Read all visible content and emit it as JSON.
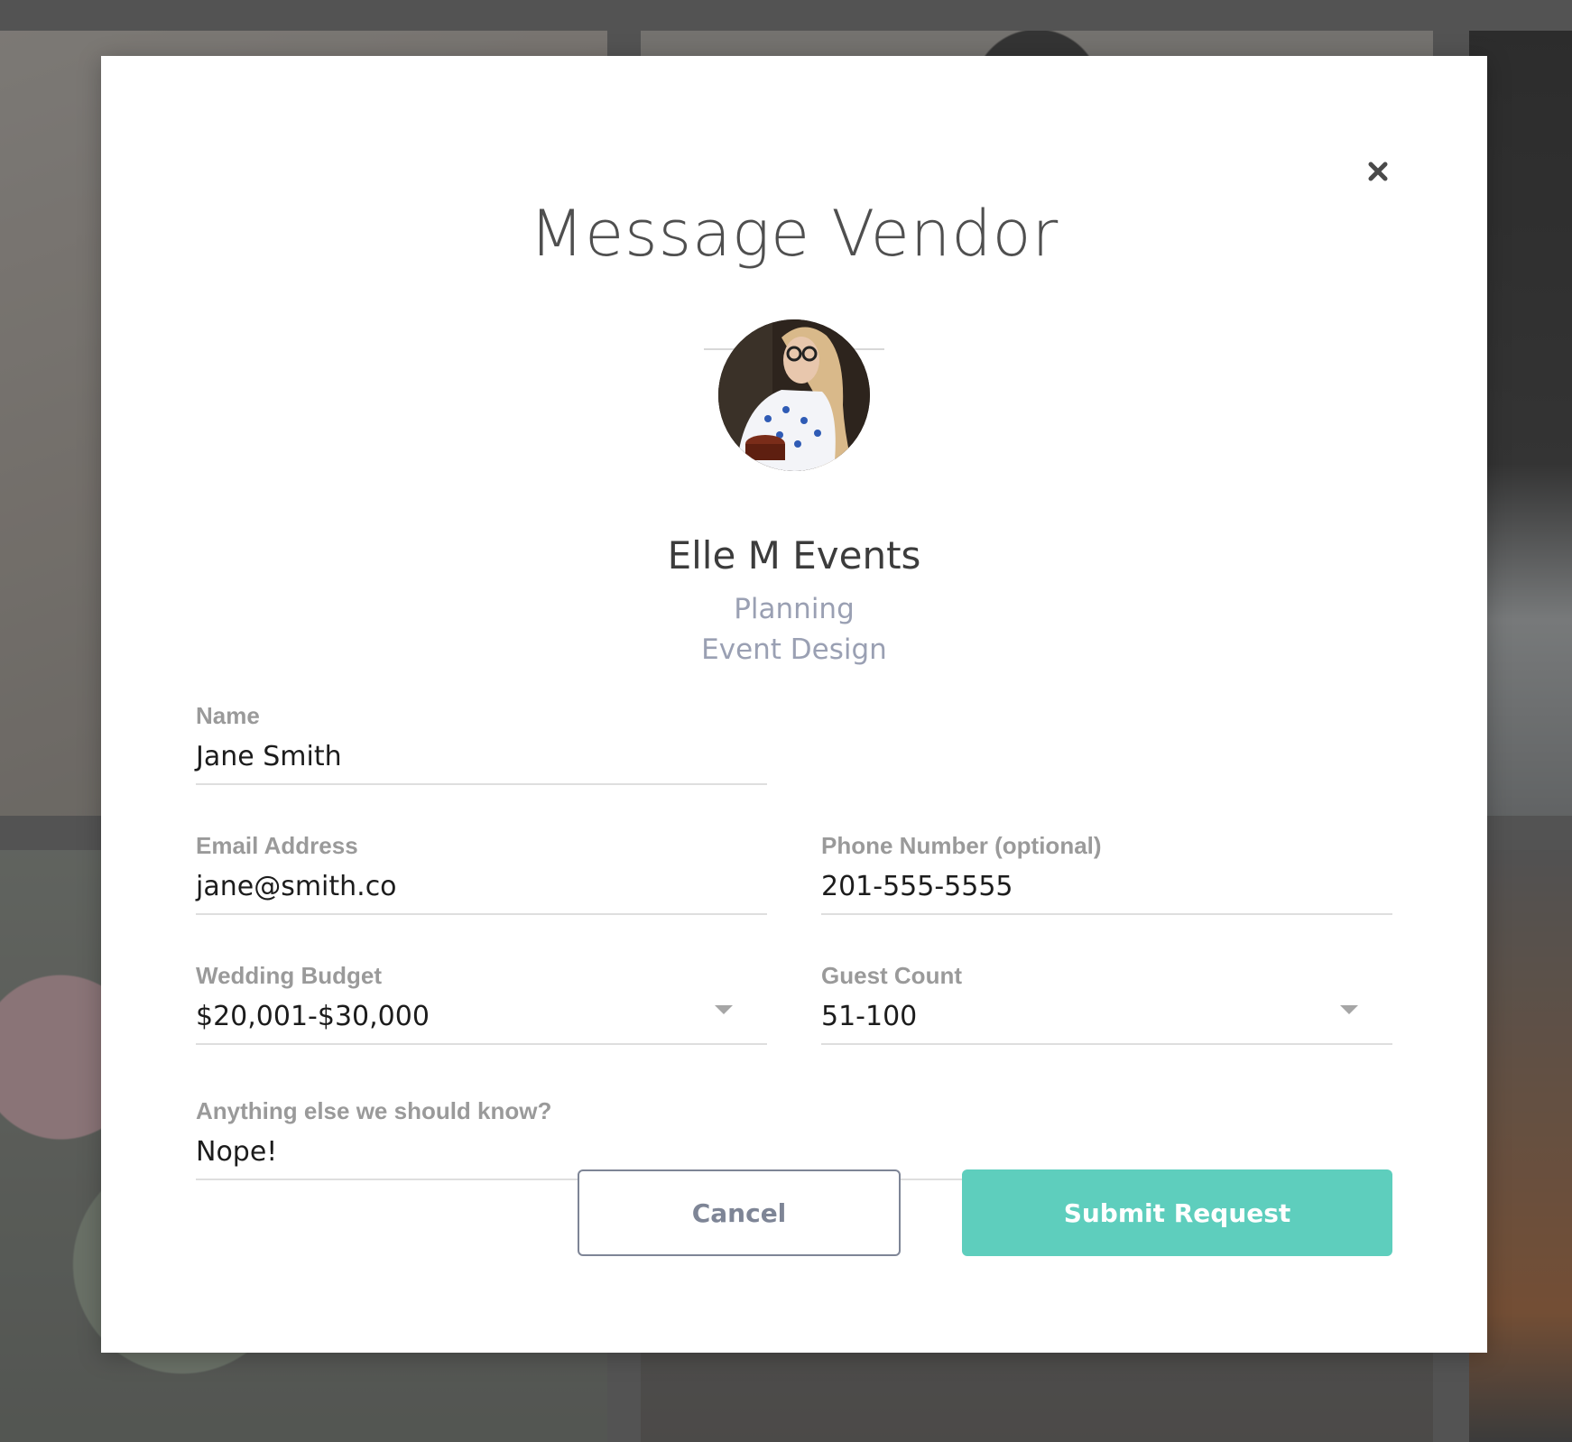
{
  "modal": {
    "title": "Message Vendor",
    "close_icon": "close-icon"
  },
  "vendor": {
    "name": "Elle M Events",
    "categories": [
      "Planning",
      "Event Design"
    ],
    "avatar_icon": "vendor-avatar"
  },
  "form": {
    "name": {
      "label": "Name",
      "value": "Jane Smith"
    },
    "email": {
      "label": "Email Address",
      "value": "jane@smith.co"
    },
    "phone": {
      "label": "Phone Number (optional)",
      "value": "201-555-5555"
    },
    "budget": {
      "label": "Wedding Budget",
      "value": "$20,001-$30,000"
    },
    "guest_count": {
      "label": "Guest Count",
      "value": "51-100"
    },
    "notes": {
      "label": "Anything else we should know?",
      "value": "Nope!"
    }
  },
  "buttons": {
    "cancel": "Cancel",
    "submit": "Submit Request"
  },
  "colors": {
    "accent": "#5ecebd",
    "cancel_border": "#7e8596",
    "label_gray": "#9a9a9a",
    "category_gray": "#9aa0b3"
  }
}
